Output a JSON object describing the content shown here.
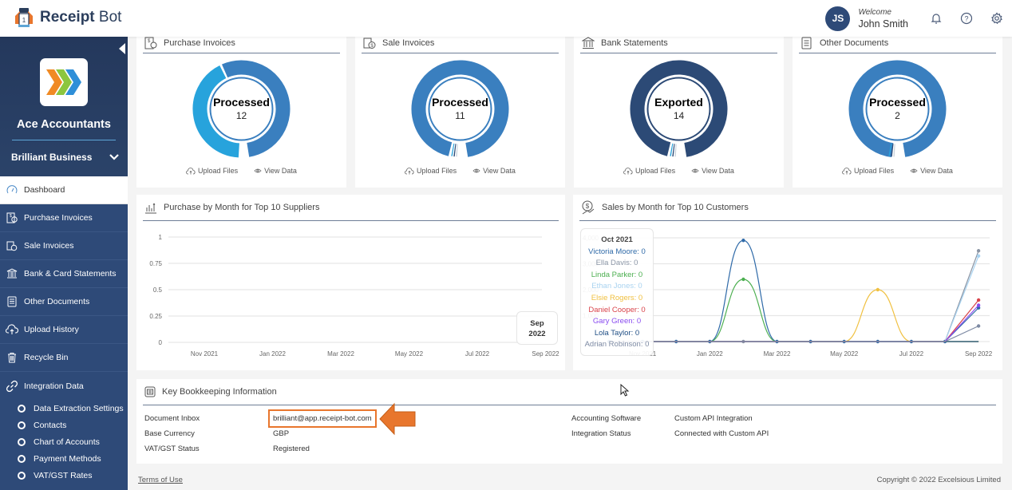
{
  "app": {
    "name_bold": "Receipt",
    "name_rest": " Bot",
    "logo_icon": "receipt-bot-robot-icon"
  },
  "header": {
    "avatar_initials": "JS",
    "welcome_label": "Welcome",
    "user_name": "John Smith",
    "icons": [
      "bell-icon",
      "help-icon",
      "gear-icon"
    ]
  },
  "sidebar": {
    "org_name": "Ace Accountants",
    "business_name": "Brilliant Business",
    "items": [
      {
        "label": "Dashboard",
        "icon": "dashboard-gauge-icon",
        "active": true
      },
      {
        "label": "Purchase Invoices",
        "icon": "purchase-invoice-icon"
      },
      {
        "label": "Sale Invoices",
        "icon": "sale-invoice-icon"
      },
      {
        "label": "Bank & Card Statements",
        "icon": "bank-icon"
      },
      {
        "label": "Other Documents",
        "icon": "document-icon"
      },
      {
        "label": "Upload History",
        "icon": "cloud-upload-icon"
      },
      {
        "label": "Recycle Bin",
        "icon": "trash-icon"
      },
      {
        "label": "Integration Data",
        "icon": "link-icon"
      }
    ],
    "sub_items": [
      {
        "label": "Data Extraction Settings"
      },
      {
        "label": "Contacts"
      },
      {
        "label": "Chart of Accounts"
      },
      {
        "label": "Payment Methods"
      },
      {
        "label": "VAT/GST Rates"
      }
    ]
  },
  "summary_cards": [
    {
      "title": "Purchase Invoices",
      "status": "Processed",
      "count": "12",
      "primary_color": "#3a7fbf",
      "secondary_color": "#27a3dc",
      "primary_fraction": 0.56,
      "actions": [
        "Upload Files",
        "View Data"
      ]
    },
    {
      "title": "Sale Invoices",
      "status": "Processed",
      "count": "11",
      "primary_color": "#3a7fbf",
      "secondary_color": "#27a3dc",
      "primary_fraction": 0.97,
      "actions": [
        "Upload Files",
        "View Data"
      ]
    },
    {
      "title": "Bank Statements",
      "status": "Exported",
      "count": "14",
      "primary_color": "#2c4a76",
      "secondary_color": "#27a3dc",
      "primary_fraction": 0.97,
      "actions": [
        "Upload Files",
        "View Data"
      ]
    },
    {
      "title": "Other Documents",
      "status": "Processed",
      "count": "2",
      "primary_color": "#3a7fbf",
      "secondary_color": "#27a3dc",
      "primary_fraction": 0.99,
      "actions": [
        "Upload Files",
        "View Data"
      ]
    }
  ],
  "chart_data": [
    {
      "type": "line",
      "title": "Purchase by Month for Top 10 Suppliers",
      "xlabel": "",
      "ylabel": "",
      "x_ticks": [
        "Nov 2021",
        "Jan 2022",
        "Mar 2022",
        "May 2022",
        "Jul 2022",
        "Sep 2022"
      ],
      "y_ticks": [
        "0",
        "0.25",
        "0.5",
        "0.75",
        "1"
      ],
      "ylim": [
        0,
        1
      ],
      "grid": true,
      "series": [],
      "tooltip": {
        "lines": [
          "Sep",
          "2022"
        ]
      }
    },
    {
      "type": "line",
      "title": "Sales by Month for Top 10 Customers",
      "xlabel": "",
      "ylabel": "",
      "x": [
        "Oct 2021",
        "Nov 2021",
        "Dec 2021",
        "Jan 2022",
        "Feb 2022",
        "Mar 2022",
        "Apr 2022",
        "May 2022",
        "Jun 2022",
        "Jul 2022",
        "Aug 2022",
        "Sep 2022"
      ],
      "x_ticks": [
        "Nov 2021",
        "Jan 2022",
        "Mar 2022",
        "May 2022",
        "Jul 2022",
        "Sep 2022"
      ],
      "y_ticks": [
        "0",
        "1,000",
        "2,000",
        "3,000",
        "4,000"
      ],
      "ylim": [
        0,
        4000
      ],
      "grid": true,
      "series": [
        {
          "name": "Victoria Moore",
          "color": "#2f6aa8",
          "values": [
            0,
            0,
            0,
            0,
            3900,
            0,
            0,
            0,
            0,
            0,
            0,
            1300
          ]
        },
        {
          "name": "Ella Davis",
          "color": "#8a95a5",
          "values": [
            0,
            0,
            0,
            0,
            0,
            0,
            0,
            0,
            0,
            0,
            0,
            3500
          ]
        },
        {
          "name": "Linda Parker",
          "color": "#4caf50",
          "values": [
            0,
            0,
            0,
            0,
            2400,
            0,
            0,
            0,
            0,
            0,
            0,
            0
          ]
        },
        {
          "name": "Ethan Jones",
          "color": "#a9d3f0",
          "values": [
            0,
            0,
            0,
            0,
            0,
            0,
            0,
            0,
            0,
            0,
            0,
            3300
          ]
        },
        {
          "name": "Elsie Rogers",
          "color": "#f0c040",
          "values": [
            0,
            0,
            0,
            0,
            0,
            0,
            0,
            0,
            2000,
            0,
            0,
            0
          ]
        },
        {
          "name": "Daniel Cooper",
          "color": "#d9434a",
          "values": [
            0,
            0,
            0,
            0,
            0,
            0,
            0,
            0,
            0,
            0,
            0,
            1600
          ]
        },
        {
          "name": "Gary Green",
          "color": "#8a4df0",
          "values": [
            0,
            0,
            0,
            0,
            0,
            0,
            0,
            0,
            0,
            0,
            0,
            1400
          ]
        },
        {
          "name": "Lola Taylor",
          "color": "#1f4e85",
          "values": [
            0,
            0,
            0,
            0,
            0,
            0,
            0,
            0,
            0,
            0,
            0,
            0
          ]
        },
        {
          "name": "Adrian Robinson",
          "color": "#7d8aa3",
          "values": [
            0,
            0,
            0,
            0,
            0,
            0,
            0,
            0,
            0,
            0,
            0,
            600
          ]
        }
      ],
      "tooltip": {
        "title": "Oct 2021",
        "entries": [
          {
            "name": "Victoria Moore",
            "value": "0"
          },
          {
            "name": "Ella Davis",
            "value": "0"
          },
          {
            "name": "Linda Parker",
            "value": "0"
          },
          {
            "name": "Ethan Jones",
            "value": "0"
          },
          {
            "name": "Elsie Rogers",
            "value": "0"
          },
          {
            "name": "Daniel Cooper",
            "value": "0"
          },
          {
            "name": "Gary Green",
            "value": "0"
          },
          {
            "name": "Lola Taylor",
            "value": "0"
          },
          {
            "name": "Adrian Robinson",
            "value": "0"
          }
        ]
      }
    }
  ],
  "bookkeeping": {
    "title": "Key Bookkeeping Information",
    "left": [
      {
        "label": "Document Inbox",
        "value": "brilliant@app.receipt-bot.com"
      },
      {
        "label": "Base Currency",
        "value": "GBP"
      },
      {
        "label": "VAT/GST Status",
        "value": "Registered"
      }
    ],
    "right": [
      {
        "label": "Accounting Software",
        "value": "Custom API Integration"
      },
      {
        "label": "Integration Status",
        "value": "Connected with Custom API"
      }
    ],
    "annotation": {
      "type": "arrow",
      "color": "#e8762d",
      "points_to": "Document Inbox value"
    }
  },
  "footer": {
    "terms": "Terms of Use",
    "copyright": "Copyright © 2022 Excelsious Limited"
  }
}
